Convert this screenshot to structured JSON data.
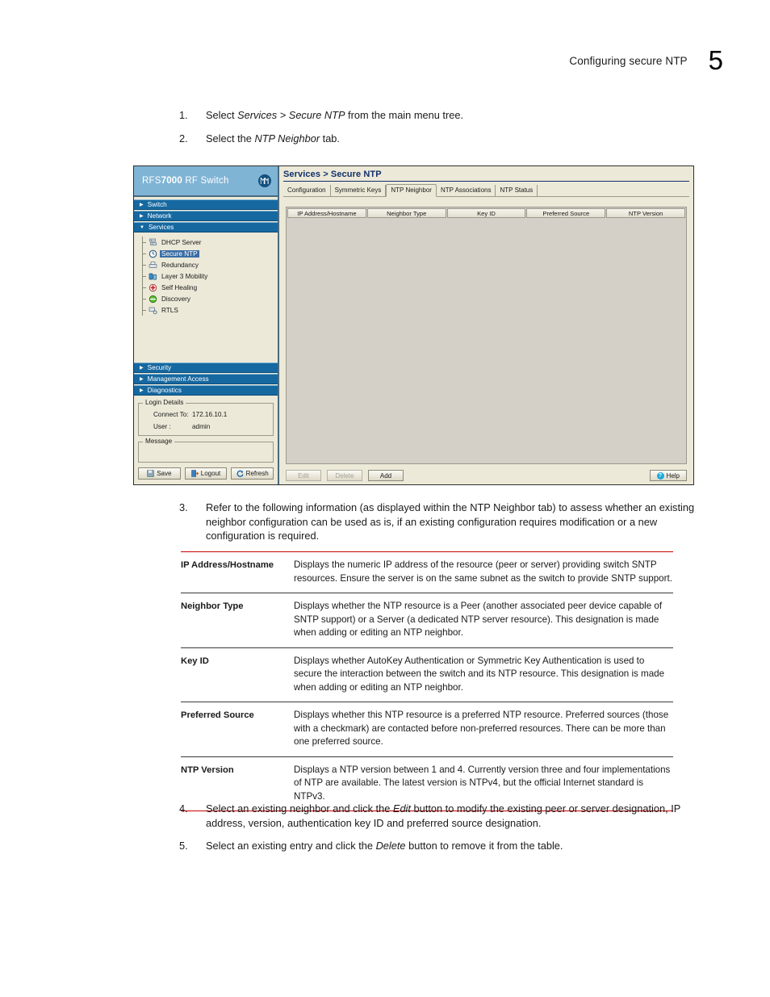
{
  "page": {
    "header_title": "Configuring secure NTP",
    "chapter_number": "5"
  },
  "steps_top": [
    {
      "num": "1.",
      "parts": [
        {
          "t": "Select ",
          "i": false
        },
        {
          "t": "Services > Secure NTP",
          "i": true
        },
        {
          "t": " from the main menu tree.",
          "i": false
        }
      ]
    },
    {
      "num": "2.",
      "parts": [
        {
          "t": "Select the ",
          "i": false
        },
        {
          "t": "NTP Neighbor",
          "i": true
        },
        {
          "t": " tab.",
          "i": false
        }
      ]
    }
  ],
  "screenshot": {
    "sidebar": {
      "brand_prefix": "RFS",
      "brand_bold": "7000",
      "brand_suffix": " RF Switch",
      "logo_name": "motorola-logo",
      "nav_top": [
        {
          "label": "Switch",
          "expanded": false
        },
        {
          "label": "Network",
          "expanded": false
        },
        {
          "label": "Services",
          "expanded": true
        }
      ],
      "tree_items": [
        {
          "label": "DHCP Server",
          "icon": "server-icon",
          "selected": false
        },
        {
          "label": "Secure NTP",
          "icon": "clock-icon",
          "selected": true
        },
        {
          "label": "Redundancy",
          "icon": "printer-icon",
          "selected": false
        },
        {
          "label": "Layer 3 Mobility",
          "icon": "mobility-icon",
          "selected": false
        },
        {
          "label": "Self Healing",
          "icon": "health-icon",
          "selected": false
        },
        {
          "label": "Discovery",
          "icon": "discovery-icon",
          "selected": false
        },
        {
          "label": "RTLS",
          "icon": "rtls-icon",
          "selected": false
        }
      ],
      "nav_bottom": [
        {
          "label": "Security",
          "expanded": false
        },
        {
          "label": "Management Access",
          "expanded": false
        },
        {
          "label": "Diagnostics",
          "expanded": false
        }
      ],
      "login_details": {
        "legend": "Login Details",
        "connect_to_label": "Connect To:",
        "connect_to_value": "172.16.10.1",
        "user_label": "User :",
        "user_value": "admin"
      },
      "message_legend": "Message",
      "buttons": [
        {
          "label": "Save",
          "icon": "save-icon"
        },
        {
          "label": "Logout",
          "icon": "logout-icon"
        },
        {
          "label": "Refresh",
          "icon": "refresh-icon"
        }
      ]
    },
    "main": {
      "title": "Services > Secure NTP",
      "tabs": [
        {
          "label": "Configuration",
          "active": false
        },
        {
          "label": "Symmetric Keys",
          "active": false
        },
        {
          "label": "NTP Neighbor",
          "active": true
        },
        {
          "label": "NTP Associations",
          "active": false
        },
        {
          "label": "NTP Status",
          "active": false
        }
      ],
      "table_columns": [
        "IP Address/Hostname",
        "Neighbor Type",
        "Key ID",
        "Preferred Source",
        "NTP Version"
      ],
      "table_rows": [],
      "actions": [
        {
          "label": "Edit",
          "disabled": true
        },
        {
          "label": "Delete",
          "disabled": true
        },
        {
          "label": "Add",
          "disabled": false
        }
      ],
      "help_label": "Help"
    }
  },
  "step3": {
    "num": "3.",
    "text": "Refer to the following information (as displayed within the NTP Neighbor tab) to assess whether an existing neighbor configuration can be used as is, if an existing configuration requires modification or a new configuration is required."
  },
  "definitions": [
    {
      "term": "IP Address/Hostname",
      "desc": "Displays the numeric IP address of the resource (peer or server) providing switch SNTP resources. Ensure the server is on the same subnet as the switch to provide SNTP support."
    },
    {
      "term": "Neighbor Type",
      "desc": "Displays whether the NTP resource is a Peer (another associated peer device capable of SNTP support) or a Server (a dedicated NTP server resource). This designation is made when adding or editing an NTP neighbor."
    },
    {
      "term": "Key ID",
      "desc": "Displays whether AutoKey Authentication or Symmetric Key Authentication is used to secure the interaction between the switch and its NTP resource. This designation is made when adding or editing an NTP neighbor."
    },
    {
      "term": "Preferred Source",
      "desc": "Displays whether this NTP resource is a preferred NTP resource. Preferred sources (those with a checkmark) are contacted before non-preferred resources. There can be more than one preferred source."
    },
    {
      "term": "NTP Version",
      "desc": "Displays a NTP version between 1 and 4. Currently version three and four implementations of NTP are available. The latest version is NTPv4, but the official Internet standard is NTPv3."
    }
  ],
  "steps_bottom": [
    {
      "num": "4.",
      "parts": [
        {
          "t": "Select an existing neighbor and click the ",
          "i": false
        },
        {
          "t": "Edit",
          "i": true
        },
        {
          "t": " button to modify the existing peer or server designation, IP address, version, authentication key ID and preferred source designation.",
          "i": false
        }
      ]
    },
    {
      "num": "5.",
      "parts": [
        {
          "t": "Select an existing entry and click the ",
          "i": false
        },
        {
          "t": "Delete",
          "i": true
        },
        {
          "t": " button to remove it from the table.",
          "i": false
        }
      ]
    }
  ],
  "colors": {
    "accent_red": "#cc0000",
    "nav_blue": "#1668a0",
    "brand_blue": "#7fb4d4",
    "title_navy": "#13306b",
    "selection_blue": "#3b6ea5",
    "panel_beige": "#ece9d8",
    "table_grey": "#d4d0c8"
  }
}
